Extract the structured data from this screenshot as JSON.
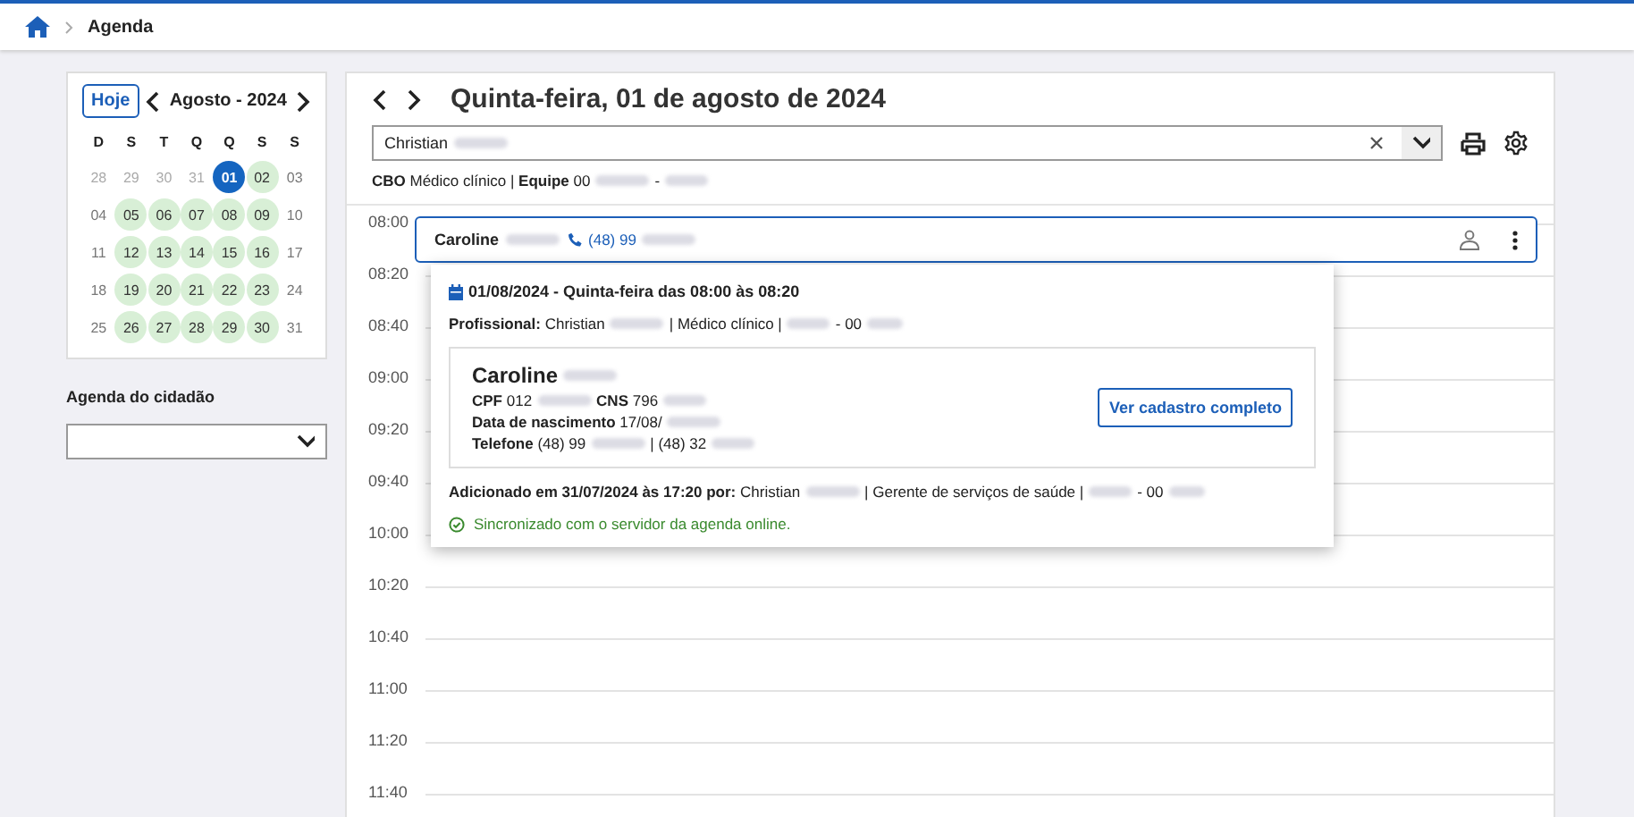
{
  "breadcrumb": {
    "items": [
      "Agenda"
    ]
  },
  "calendar": {
    "today_button": "Hoje",
    "month_label": "Agosto - 2024",
    "weekdays": [
      "D",
      "S",
      "T",
      "Q",
      "Q",
      "S",
      "S"
    ],
    "weeks": [
      [
        {
          "day": "28",
          "kind": "outside",
          "selected": false
        },
        {
          "day": "29",
          "kind": "outside",
          "selected": false
        },
        {
          "day": "30",
          "kind": "outside",
          "selected": false
        },
        {
          "day": "31",
          "kind": "outside",
          "selected": false
        },
        {
          "day": "01",
          "kind": "available",
          "selected": true
        },
        {
          "day": "02",
          "kind": "available",
          "selected": false
        },
        {
          "day": "03",
          "kind": "normal",
          "selected": false
        }
      ],
      [
        {
          "day": "04",
          "kind": "normal",
          "selected": false
        },
        {
          "day": "05",
          "kind": "available",
          "selected": false
        },
        {
          "day": "06",
          "kind": "available",
          "selected": false
        },
        {
          "day": "07",
          "kind": "available",
          "selected": false
        },
        {
          "day": "08",
          "kind": "available",
          "selected": false
        },
        {
          "day": "09",
          "kind": "available",
          "selected": false
        },
        {
          "day": "10",
          "kind": "normal",
          "selected": false
        }
      ],
      [
        {
          "day": "11",
          "kind": "normal",
          "selected": false
        },
        {
          "day": "12",
          "kind": "available",
          "selected": false
        },
        {
          "day": "13",
          "kind": "available",
          "selected": false
        },
        {
          "day": "14",
          "kind": "available",
          "selected": false
        },
        {
          "day": "15",
          "kind": "available",
          "selected": false
        },
        {
          "day": "16",
          "kind": "available",
          "selected": false
        },
        {
          "day": "17",
          "kind": "normal",
          "selected": false
        }
      ],
      [
        {
          "day": "18",
          "kind": "normal",
          "selected": false
        },
        {
          "day": "19",
          "kind": "available",
          "selected": false
        },
        {
          "day": "20",
          "kind": "available",
          "selected": false
        },
        {
          "day": "21",
          "kind": "available",
          "selected": false
        },
        {
          "day": "22",
          "kind": "available",
          "selected": false
        },
        {
          "day": "23",
          "kind": "available",
          "selected": false
        },
        {
          "day": "24",
          "kind": "normal",
          "selected": false
        }
      ],
      [
        {
          "day": "25",
          "kind": "normal",
          "selected": false
        },
        {
          "day": "26",
          "kind": "available",
          "selected": false
        },
        {
          "day": "27",
          "kind": "available",
          "selected": false
        },
        {
          "day": "28",
          "kind": "available",
          "selected": false
        },
        {
          "day": "29",
          "kind": "available",
          "selected": false
        },
        {
          "day": "30",
          "kind": "available",
          "selected": false
        },
        {
          "day": "31",
          "kind": "normal",
          "selected": false
        }
      ]
    ]
  },
  "citizen_agenda": {
    "label": "Agenda do cidadão"
  },
  "day_view": {
    "title": "Quinta-feira, 01 de agosto de 2024",
    "professional_field": {
      "parts": [
        "Christian"
      ]
    },
    "info": {
      "parts": [
        "**CBO** Médico clínico | **Equipe** 00",
        "-"
      ]
    },
    "times": [
      "08:00",
      "08:20",
      "08:40",
      "09:00",
      "09:20",
      "09:40",
      "10:00",
      "10:20",
      "10:40",
      "11:00",
      "11:20",
      "11:40"
    ],
    "appointment": {
      "name": {
        "parts": [
          "Caroline"
        ]
      },
      "phone": {
        "parts": [
          "(48) 99"
        ]
      }
    },
    "popover": {
      "heading": "01/08/2024 - Quinta-feira das 08:00 às 08:20",
      "professional": {
        "parts": [
          "**Profissional:** Christian",
          "| Médico clínico |",
          "- 00"
        ]
      },
      "patient": {
        "name": {
          "parts": [
            "Caroline"
          ]
        },
        "lines": [
          {
            "parts": [
              "**CPF** 012",
              "**CNS** 796"
            ]
          },
          {
            "parts": [
              "**Data de nascimento** 17/08/"
            ]
          },
          {
            "parts": [
              "**Telefone** (48) 99",
              "| (48) 32"
            ]
          }
        ],
        "button": "Ver cadastro completo"
      },
      "added": {
        "parts": [
          "**Adicionado em 31/07/2024 às 17:20 por:** Christian",
          "| Gerente de serviços de saúde |",
          "- 00"
        ]
      },
      "sync": "Sincronizado com o servidor da agenda online."
    }
  }
}
